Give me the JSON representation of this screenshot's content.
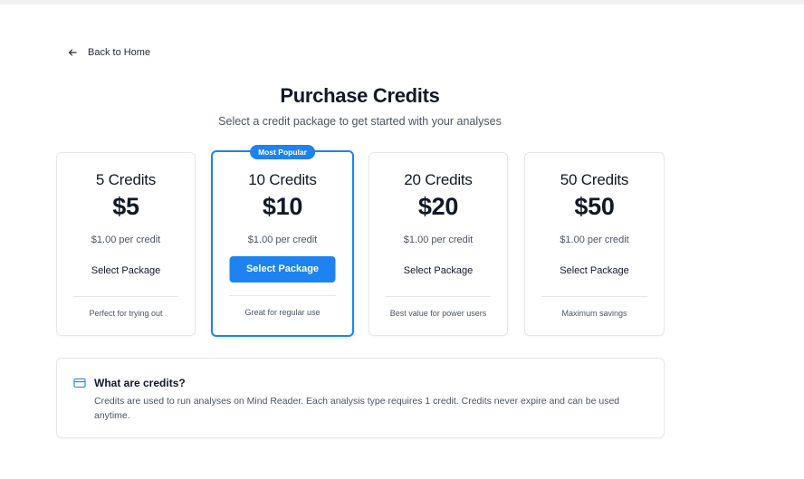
{
  "nav": {
    "back_label": "Back to Home"
  },
  "header": {
    "title": "Purchase Credits",
    "subtitle": "Select a credit package to get started with your analyses"
  },
  "packages": [
    {
      "name": "5 Credits",
      "price": "$5",
      "per_credit": "$1.00 per credit",
      "button": "Select Package",
      "note": "Perfect for trying out"
    },
    {
      "name": "10 Credits",
      "price": "$10",
      "per_credit": "$1.00 per credit",
      "button": "Select Package",
      "note": "Great for regular use",
      "badge": "Most Popular"
    },
    {
      "name": "20 Credits",
      "price": "$20",
      "per_credit": "$1.00 per credit",
      "button": "Select Package",
      "note": "Best value for power users"
    },
    {
      "name": "50 Credits",
      "price": "$50",
      "per_credit": "$1.00 per credit",
      "button": "Select Package",
      "note": "Maximum savings"
    }
  ],
  "info": {
    "icon": "credit-card-icon",
    "title": "What are credits?",
    "text": "Credits are used to run analyses on Mind Reader. Each analysis type requires 1 credit. Credits never expire and can be used anytime."
  },
  "colors": {
    "accent": "#1d83f0",
    "text": "#111827",
    "muted": "#4b5563",
    "border": "#e5e7eb"
  }
}
